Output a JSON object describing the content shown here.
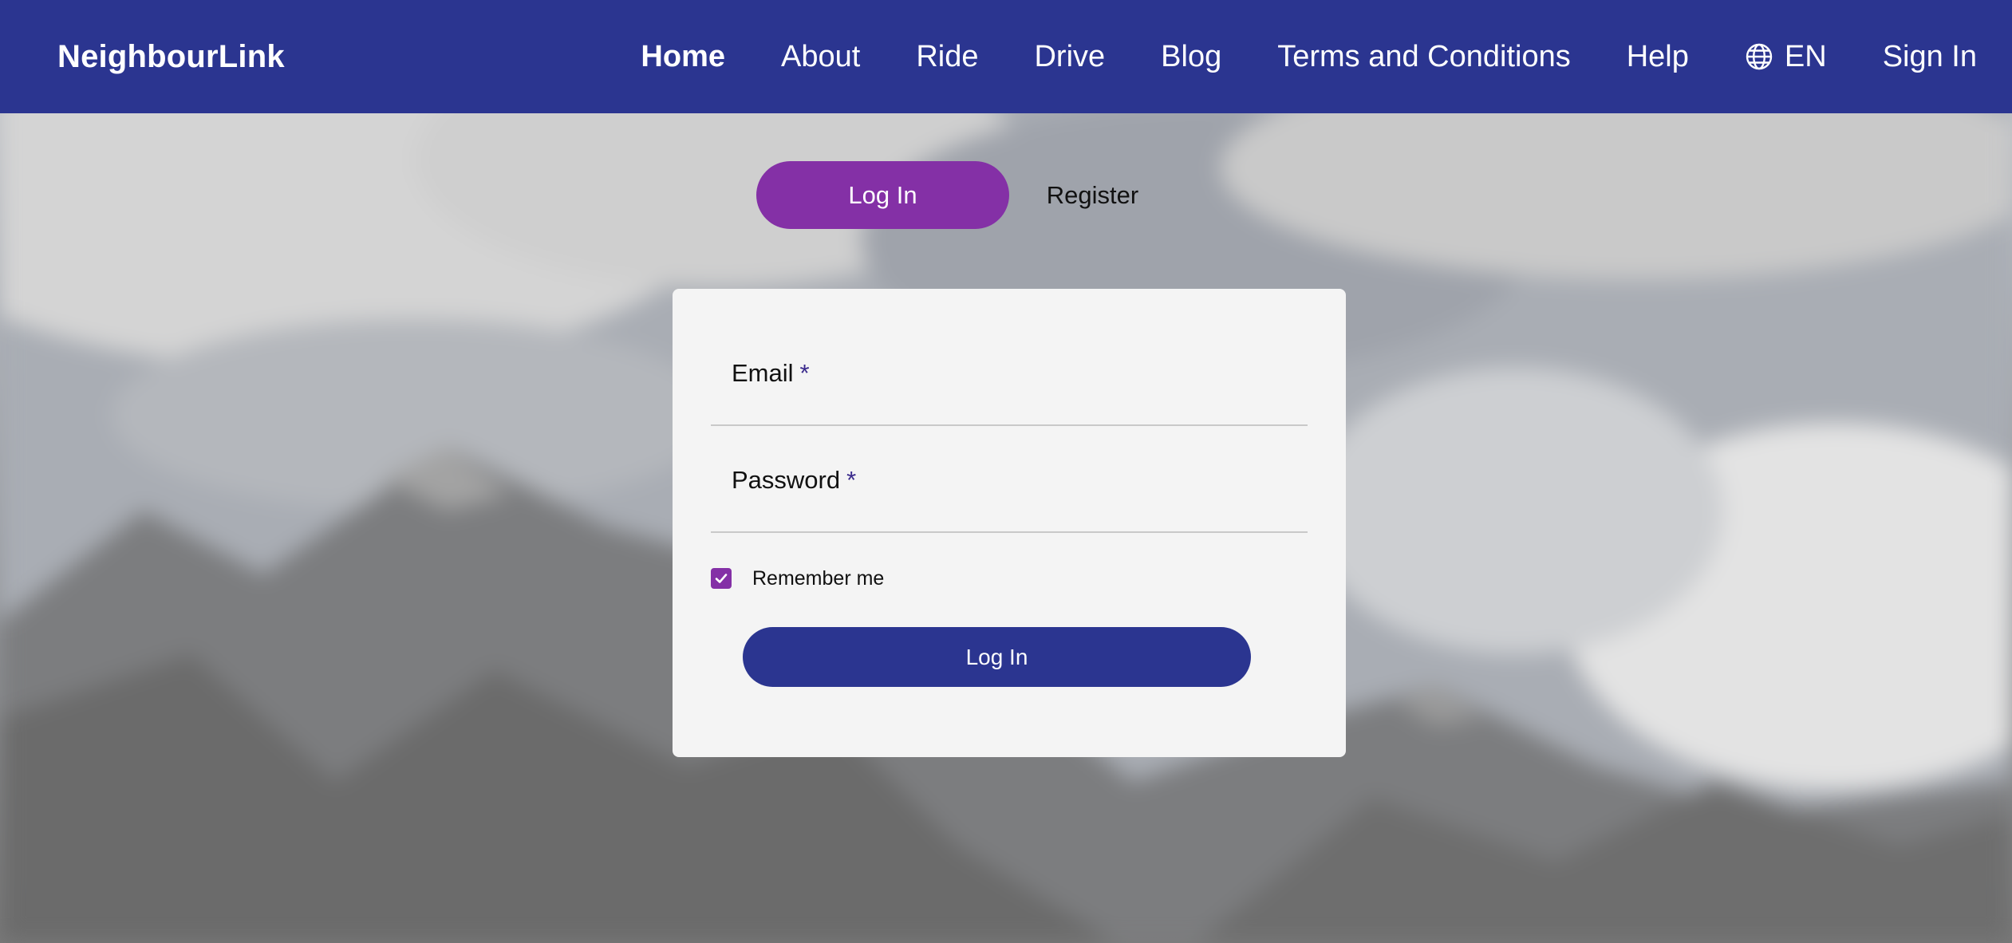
{
  "navbar": {
    "brand": "NeighbourLink",
    "links": [
      {
        "label": "Home",
        "active": true
      },
      {
        "label": "About"
      },
      {
        "label": "Ride"
      },
      {
        "label": "Drive"
      },
      {
        "label": "Blog"
      },
      {
        "label": "Terms and Conditions"
      },
      {
        "label": "Help"
      }
    ],
    "language": {
      "icon": "globe-icon",
      "label": "EN"
    },
    "sign_in": "Sign In"
  },
  "auth_tabs": {
    "login": {
      "label": "Log In",
      "active": true
    },
    "register": {
      "label": "Register",
      "active": false
    }
  },
  "form": {
    "email": {
      "label": "Email",
      "required_mark": "*",
      "value": "",
      "placeholder": ""
    },
    "password": {
      "label": "Password",
      "required_mark": "*",
      "value": "",
      "placeholder": ""
    },
    "remember_me": {
      "label": "Remember me",
      "checked": true,
      "icon": "checkmark-icon"
    },
    "submit_label": "Log In"
  },
  "colors": {
    "nav_bg": "#2b3590",
    "accent_purple": "#8430a6",
    "card_bg": "#f4f4f4",
    "submit_bg": "#2b3590"
  }
}
